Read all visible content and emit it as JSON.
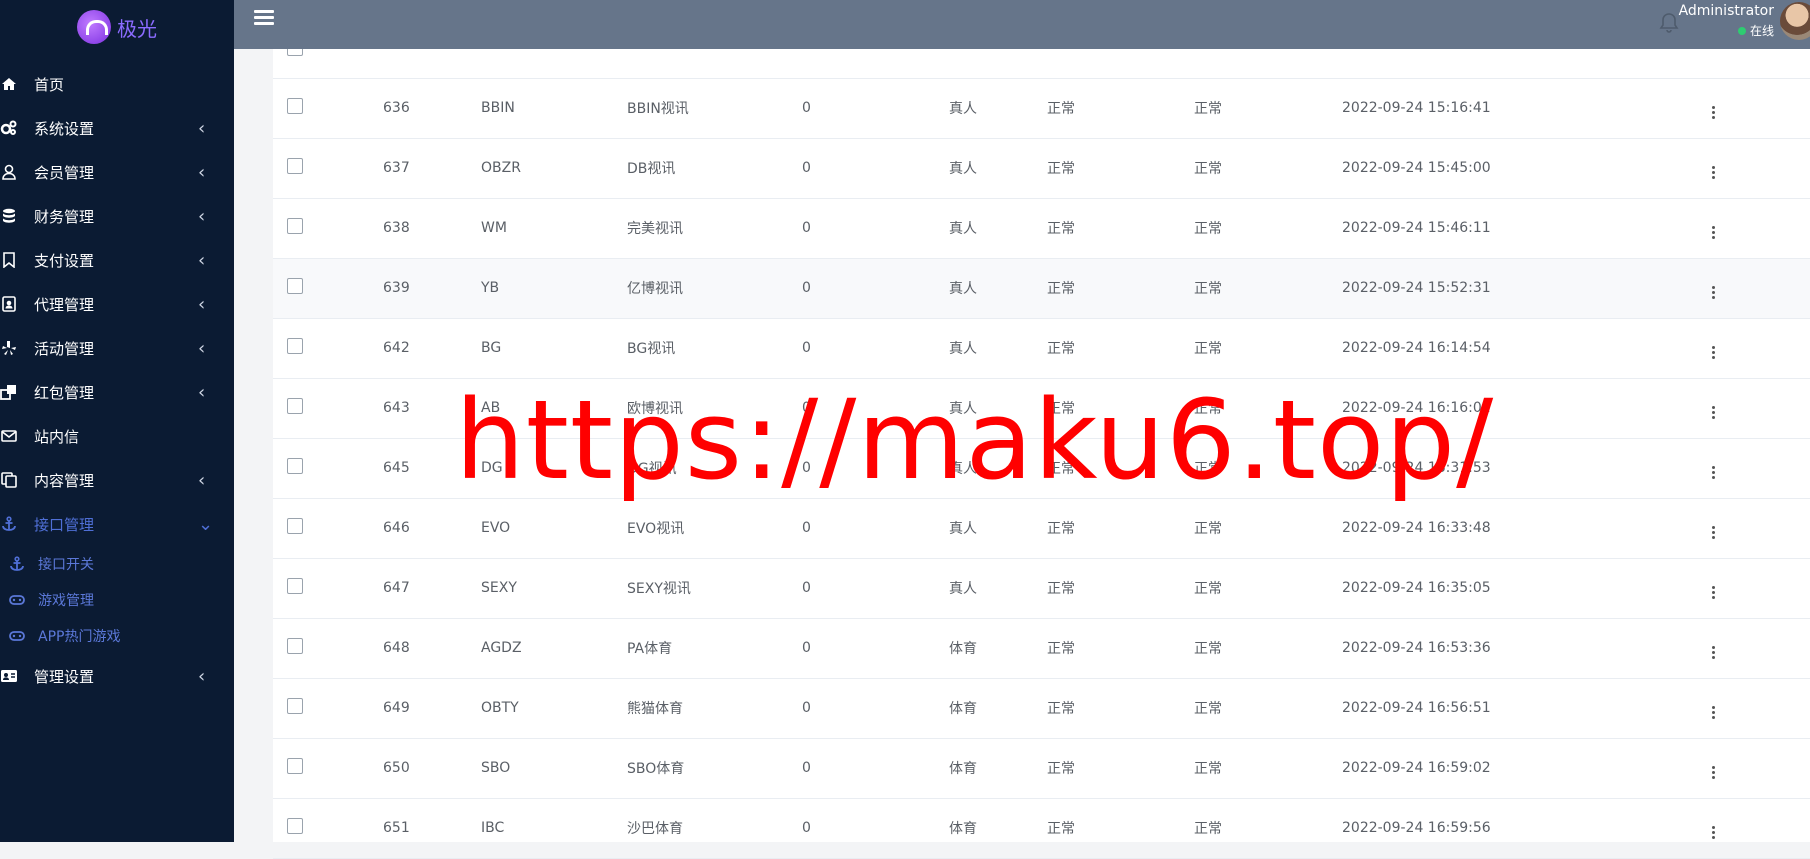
{
  "brand": {
    "name": "极光"
  },
  "sidebar": {
    "items": [
      {
        "label": "首页",
        "icon": "home-icon",
        "chevron": ""
      },
      {
        "label": "系统设置",
        "icon": "cogs-icon",
        "chevron": "‹"
      },
      {
        "label": "会员管理",
        "icon": "user-icon",
        "chevron": "‹"
      },
      {
        "label": "财务管理",
        "icon": "database-icon",
        "chevron": "‹"
      },
      {
        "label": "支付设置",
        "icon": "bookmark-icon",
        "chevron": "‹"
      },
      {
        "label": "代理管理",
        "icon": "contact-card-icon",
        "chevron": "‹"
      },
      {
        "label": "活动管理",
        "icon": "yelp-icon",
        "chevron": "‹"
      },
      {
        "label": "红包管理",
        "icon": "clone-icon",
        "chevron": "‹"
      },
      {
        "label": "站内信",
        "icon": "envelope-icon",
        "chevron": ""
      },
      {
        "label": "内容管理",
        "icon": "copy-icon",
        "chevron": "‹"
      },
      {
        "label": "接口管理",
        "icon": "anchor-icon",
        "chevron": "⌄"
      }
    ],
    "subitems": [
      {
        "label": "接口开关",
        "icon": "anchor-icon"
      },
      {
        "label": "游戏管理",
        "icon": "gamepad-icon"
      },
      {
        "label": "APP热门游戏",
        "icon": "gamepad-icon"
      }
    ],
    "footer_item": {
      "label": "管理设置",
      "icon": "id-card-icon",
      "chevron": "‹"
    }
  },
  "header": {
    "user_name": "Administrator",
    "user_status": "在线"
  },
  "table": {
    "rows": [
      {
        "id": "636",
        "code": "BBIN",
        "name": "BBIN视讯",
        "count": "0",
        "type": "真人",
        "status1": "正常",
        "status2": "正常",
        "time": "2022-09-24 15:16:41"
      },
      {
        "id": "637",
        "code": "OBZR",
        "name": "DB视讯",
        "count": "0",
        "type": "真人",
        "status1": "正常",
        "status2": "正常",
        "time": "2022-09-24 15:45:00"
      },
      {
        "id": "638",
        "code": "WM",
        "name": "完美视讯",
        "count": "0",
        "type": "真人",
        "status1": "正常",
        "status2": "正常",
        "time": "2022-09-24 15:46:11"
      },
      {
        "id": "639",
        "code": "YB",
        "name": "亿博视讯",
        "count": "0",
        "type": "真人",
        "status1": "正常",
        "status2": "正常",
        "time": "2022-09-24 15:52:31"
      },
      {
        "id": "642",
        "code": "BG",
        "name": "BG视讯",
        "count": "0",
        "type": "真人",
        "status1": "正常",
        "status2": "正常",
        "time": "2022-09-24 16:14:54"
      },
      {
        "id": "643",
        "code": "AB",
        "name": "欧博视讯",
        "count": "0",
        "type": "真人",
        "status1": "正常",
        "status2": "正常",
        "time": "2022-09-24 16:16:02"
      },
      {
        "id": "645",
        "code": "DG",
        "name": "DG视讯",
        "count": "0",
        "type": "真人",
        "status1": "正常",
        "status2": "正常",
        "time": "2022-09-24 16:31:53"
      },
      {
        "id": "646",
        "code": "EVO",
        "name": "EVO视讯",
        "count": "0",
        "type": "真人",
        "status1": "正常",
        "status2": "正常",
        "time": "2022-09-24 16:33:48"
      },
      {
        "id": "647",
        "code": "SEXY",
        "name": "SEXY视讯",
        "count": "0",
        "type": "真人",
        "status1": "正常",
        "status2": "正常",
        "time": "2022-09-24 16:35:05"
      },
      {
        "id": "648",
        "code": "AGDZ",
        "name": "PA体育",
        "count": "0",
        "type": "体育",
        "status1": "正常",
        "status2": "正常",
        "time": "2022-09-24 16:53:36"
      },
      {
        "id": "649",
        "code": "OBTY",
        "name": "熊猫体育",
        "count": "0",
        "type": "体育",
        "status1": "正常",
        "status2": "正常",
        "time": "2022-09-24 16:56:51"
      },
      {
        "id": "650",
        "code": "SBO",
        "name": "SBO体育",
        "count": "0",
        "type": "体育",
        "status1": "正常",
        "status2": "正常",
        "time": "2022-09-24 16:59:02"
      },
      {
        "id": "651",
        "code": "IBC",
        "name": "沙巴体育",
        "count": "0",
        "type": "体育",
        "status1": "正常",
        "status2": "正常",
        "time": "2022-09-24 16:59:56"
      }
    ]
  },
  "watermark": "https://maku6.top/"
}
